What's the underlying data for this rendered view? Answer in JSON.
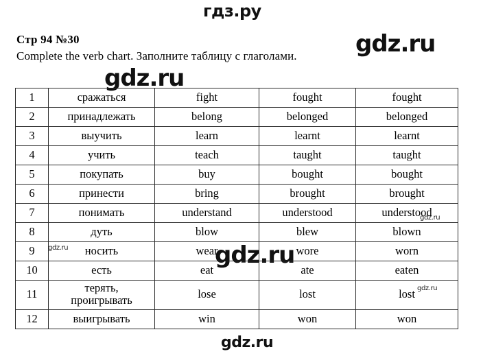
{
  "document": {
    "page_reference": "Стр 94 №30",
    "task_instruction": "Complete the verb chart. Заполните таблицу с глаголами."
  },
  "watermarks": {
    "top_logo": "гдз.ру",
    "right_big": "gdz.ru",
    "under_header": "gdz.ru",
    "middle_big": "gdz.ru",
    "bottom": "gdz.ru",
    "small_1": "gdz.ru",
    "small_2": "gdz.ru",
    "small_3": "gdz.ru"
  },
  "table": {
    "rows": [
      {
        "num": "1",
        "ru": "сражаться",
        "infinitive": "fight",
        "past": "fought",
        "participle": "fought"
      },
      {
        "num": "2",
        "ru": "принадлежать",
        "infinitive": "belong",
        "past": "belonged",
        "participle": "belonged"
      },
      {
        "num": "3",
        "ru": "выучить",
        "infinitive": "learn",
        "past": "learnt",
        "participle": "learnt"
      },
      {
        "num": "4",
        "ru": "учить",
        "infinitive": "teach",
        "past": "taught",
        "participle": "taught"
      },
      {
        "num": "5",
        "ru": "покупать",
        "infinitive": "buy",
        "past": "bought",
        "participle": "bought"
      },
      {
        "num": "6",
        "ru": "принести",
        "infinitive": "bring",
        "past": "brought",
        "participle": "brought"
      },
      {
        "num": "7",
        "ru": "понимать",
        "infinitive": "understand",
        "past": "understood",
        "participle": "understood"
      },
      {
        "num": "8",
        "ru": "дуть",
        "infinitive": "blow",
        "past": "blew",
        "participle": "blown"
      },
      {
        "num": "9",
        "ru": "носить",
        "infinitive": "wear",
        "past": "wore",
        "participle": "worn"
      },
      {
        "num": "10",
        "ru": "есть",
        "infinitive": "eat",
        "past": "ate",
        "participle": "eaten"
      },
      {
        "num": "11",
        "ru": "терять,\nпроигрывать",
        "infinitive": "lose",
        "past": "lost",
        "participle": "lost"
      },
      {
        "num": "12",
        "ru": "выигрывать",
        "infinitive": "win",
        "past": "won",
        "participle": "won"
      }
    ]
  }
}
